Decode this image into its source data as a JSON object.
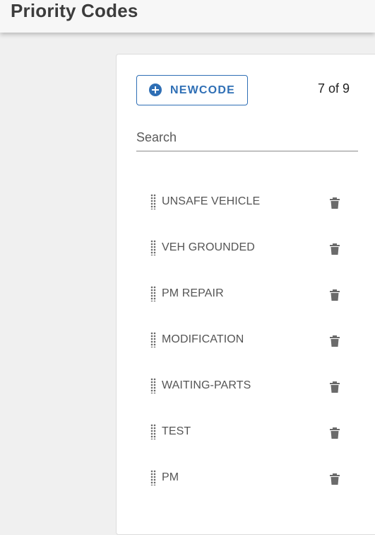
{
  "header": {
    "title": "Priority Codes"
  },
  "toolbar": {
    "new_code_label": "NEWCODE",
    "count_text": "7 of 9"
  },
  "search": {
    "placeholder": "Search",
    "value": ""
  },
  "codes": [
    {
      "label": "UNSAFE VEHICLE"
    },
    {
      "label": "VEH GROUNDED"
    },
    {
      "label": "PM REPAIR"
    },
    {
      "label": "MODIFICATION"
    },
    {
      "label": "WAITING-PARTS"
    },
    {
      "label": "TEST"
    },
    {
      "label": "PM"
    }
  ],
  "colors": {
    "accent": "#2f6fb5",
    "text": "#555555",
    "icon": "#6b6b6b"
  }
}
